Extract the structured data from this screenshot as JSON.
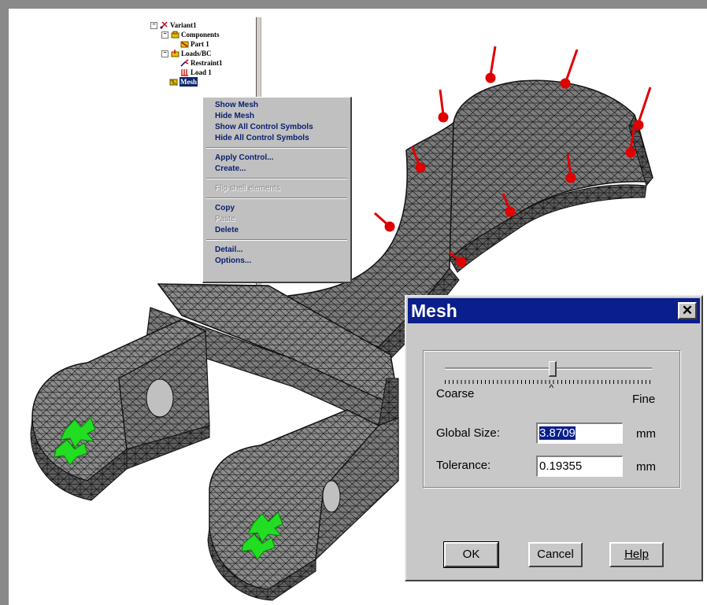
{
  "tree": {
    "items": [
      {
        "label": "Variant1",
        "level": 0,
        "icon": "variant-icon"
      },
      {
        "label": "Components",
        "level": 1,
        "icon": "components-icon"
      },
      {
        "label": "Part 1",
        "level": 2,
        "icon": "part-icon"
      },
      {
        "label": "Loads/BC",
        "level": 1,
        "icon": "loads-icon"
      },
      {
        "label": "Restraint1",
        "level": 2,
        "icon": "restraint-icon"
      },
      {
        "label": "Load 1",
        "level": 2,
        "icon": "load-icon"
      },
      {
        "label": "Mesh",
        "level": 1,
        "icon": "mesh-icon",
        "selected": true
      }
    ]
  },
  "context_menu": {
    "items": [
      {
        "label": "Show Mesh",
        "enabled": true
      },
      {
        "label": "Hide Mesh",
        "enabled": true
      },
      {
        "label": "Show All Control Symbols",
        "enabled": true
      },
      {
        "label": "Hide All Control Symbols",
        "enabled": true
      },
      {
        "label": "Apply Control...",
        "enabled": true
      },
      {
        "label": "Create...",
        "enabled": true
      },
      {
        "label": "Flip shell elements",
        "enabled": false
      },
      {
        "label": "Copy",
        "enabled": true
      },
      {
        "label": "Paste",
        "enabled": false
      },
      {
        "label": "Delete",
        "enabled": true
      },
      {
        "label": "Detail...",
        "enabled": true
      },
      {
        "label": "Options...",
        "enabled": true
      }
    ]
  },
  "dialog": {
    "title": "Mesh",
    "slider": {
      "min_label": "Coarse",
      "max_label": "Fine",
      "position": 0.52
    },
    "global_size": {
      "label": "Global Size:",
      "value": "3.8709",
      "unit": "mm"
    },
    "tolerance": {
      "label": "Tolerance:",
      "value": "0.19355",
      "unit": "mm"
    },
    "buttons": {
      "ok": "OK",
      "cancel": "Cancel",
      "help": "Help"
    }
  },
  "colors": {
    "mesh_fill": "#7a7a7a",
    "load_arrow": "#e00000",
    "restraint": "#22dd22",
    "title_bar": "#0a1e8c"
  }
}
